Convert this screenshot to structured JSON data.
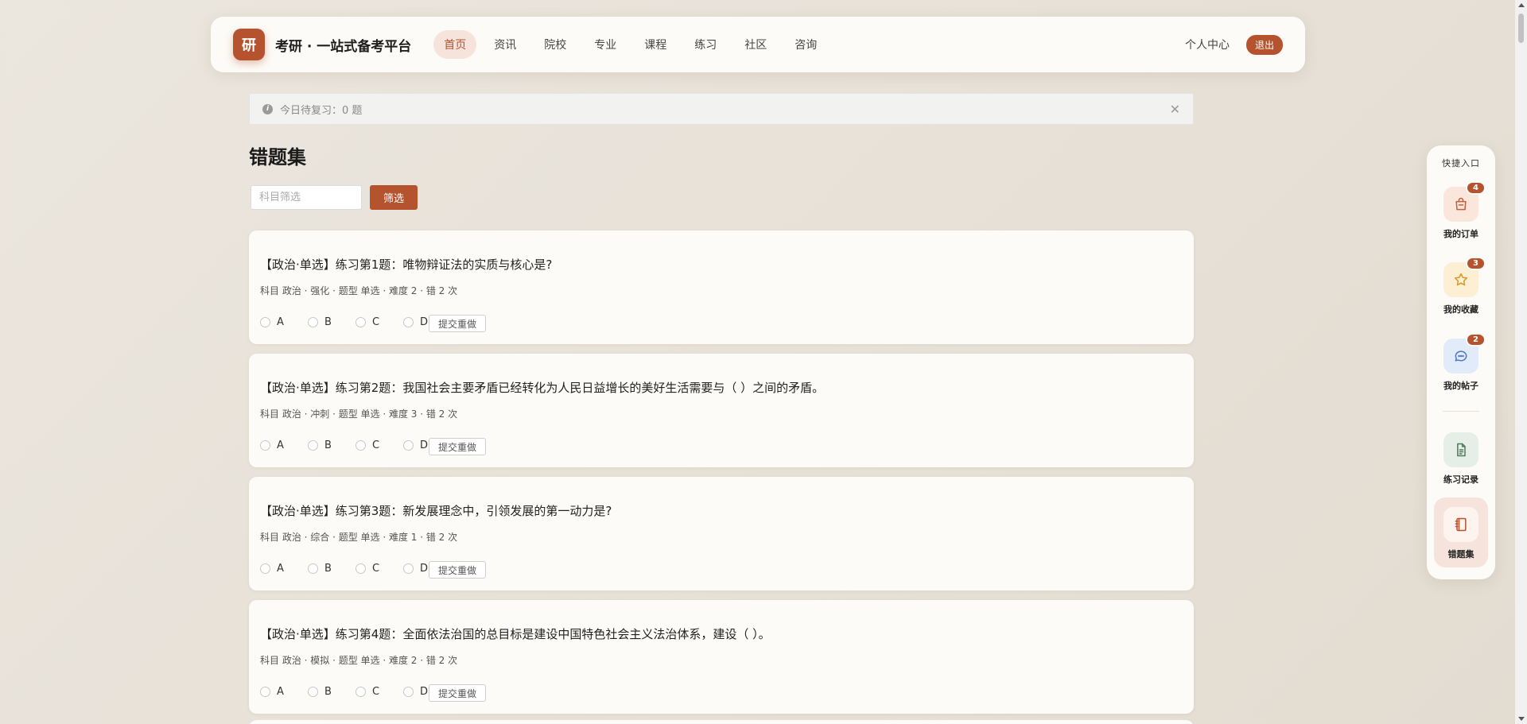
{
  "header": {
    "logo_char": "研",
    "brand": "考研 · 一站式备考平台",
    "nav": [
      {
        "label": "首页",
        "active": true
      },
      {
        "label": "资讯",
        "active": false
      },
      {
        "label": "院校",
        "active": false
      },
      {
        "label": "专业",
        "active": false
      },
      {
        "label": "课程",
        "active": false
      },
      {
        "label": "练习",
        "active": false
      },
      {
        "label": "社区",
        "active": false
      },
      {
        "label": "咨询",
        "active": false
      }
    ],
    "profile_label": "个人中心",
    "logout_label": "退出"
  },
  "alert": {
    "text": "今日待复习：0 题",
    "icon": "info-icon",
    "close_icon": "close-icon"
  },
  "page_title": "错题集",
  "filter": {
    "placeholder": "科目筛选",
    "value": "",
    "button_label": "筛选"
  },
  "questions": [
    {
      "text": "【政治·单选】练习第1题：唯物辩证法的实质与核心是?",
      "meta": "科目 政治 · 强化 · 题型 单选 · 难度 2 · 错 2 次",
      "options": [
        "A",
        "B",
        "C",
        "D"
      ],
      "button_label": "提交重做"
    },
    {
      "text": "【政治·单选】练习第2题：我国社会主要矛盾已经转化为人民日益增长的美好生活需要与（ ）之间的矛盾。",
      "meta": "科目 政治 · 冲刺 · 题型 单选 · 难度 3 · 错 2 次",
      "options": [
        "A",
        "B",
        "C",
        "D"
      ],
      "button_label": "提交重做"
    },
    {
      "text": "【政治·单选】练习第3题：新发展理念中，引领发展的第一动力是?",
      "meta": "科目 政治 · 综合 · 题型 单选 · 难度 1 · 错 2 次",
      "options": [
        "A",
        "B",
        "C",
        "D"
      ],
      "button_label": "提交重做"
    },
    {
      "text": "【政治·单选】练习第4题：全面依法治国的总目标是建设中国特色社会主义法治体系，建设（ ）。",
      "meta": "科目 政治 · 模拟 · 题型 单选 · 难度 2 · 错 2 次",
      "options": [
        "A",
        "B",
        "C",
        "D"
      ],
      "button_label": "提交重做"
    }
  ],
  "quick": {
    "title": "快捷入口",
    "items": [
      {
        "label": "我的订单",
        "icon": "shopping-bag-icon",
        "badge": "4",
        "icon_bg": "#fbe6dc",
        "icon_color": "#c0613c"
      },
      {
        "label": "我的收藏",
        "icon": "star-icon",
        "badge": "3",
        "icon_bg": "#fcefd3",
        "icon_color": "#d79a2b"
      },
      {
        "label": "我的帖子",
        "icon": "chat-bubble-icon",
        "badge": "2",
        "icon_bg": "#e1ebf9",
        "icon_color": "#4a78c2"
      },
      {
        "label": "练习记录",
        "icon": "document-icon",
        "badge": "",
        "icon_bg": "#e5efe8",
        "icon_color": "#4f7a5c"
      },
      {
        "label": "错题集",
        "icon": "notebook-icon",
        "badge": "",
        "icon_bg": "#fdf3ef",
        "icon_color": "#b5532f",
        "active": true
      }
    ]
  }
}
